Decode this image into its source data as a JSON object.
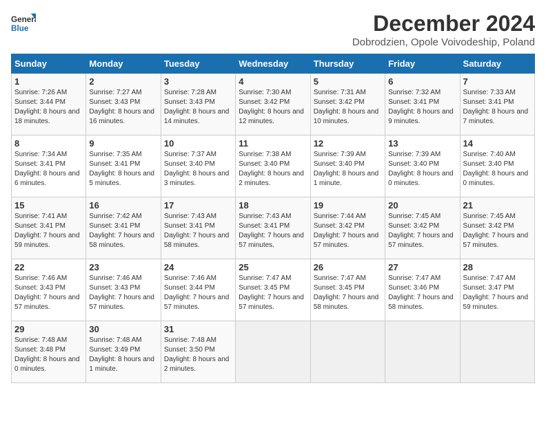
{
  "logo": {
    "line1": "General",
    "line2": "Blue"
  },
  "title": "December 2024",
  "subtitle": "Dobrodzien, Opole Voivodeship, Poland",
  "days_of_week": [
    "Sunday",
    "Monday",
    "Tuesday",
    "Wednesday",
    "Thursday",
    "Friday",
    "Saturday"
  ],
  "weeks": [
    [
      {
        "day": "1",
        "sunrise": "7:26 AM",
        "sunset": "3:44 PM",
        "daylight": "8 hours and 18 minutes."
      },
      {
        "day": "2",
        "sunrise": "7:27 AM",
        "sunset": "3:43 PM",
        "daylight": "8 hours and 16 minutes."
      },
      {
        "day": "3",
        "sunrise": "7:28 AM",
        "sunset": "3:43 PM",
        "daylight": "8 hours and 14 minutes."
      },
      {
        "day": "4",
        "sunrise": "7:30 AM",
        "sunset": "3:42 PM",
        "daylight": "8 hours and 12 minutes."
      },
      {
        "day": "5",
        "sunrise": "7:31 AM",
        "sunset": "3:42 PM",
        "daylight": "8 hours and 10 minutes."
      },
      {
        "day": "6",
        "sunrise": "7:32 AM",
        "sunset": "3:41 PM",
        "daylight": "8 hours and 9 minutes."
      },
      {
        "day": "7",
        "sunrise": "7:33 AM",
        "sunset": "3:41 PM",
        "daylight": "8 hours and 7 minutes."
      }
    ],
    [
      {
        "day": "8",
        "sunrise": "7:34 AM",
        "sunset": "3:41 PM",
        "daylight": "8 hours and 6 minutes."
      },
      {
        "day": "9",
        "sunrise": "7:35 AM",
        "sunset": "3:41 PM",
        "daylight": "8 hours and 5 minutes."
      },
      {
        "day": "10",
        "sunrise": "7:37 AM",
        "sunset": "3:40 PM",
        "daylight": "8 hours and 3 minutes."
      },
      {
        "day": "11",
        "sunrise": "7:38 AM",
        "sunset": "3:40 PM",
        "daylight": "8 hours and 2 minutes."
      },
      {
        "day": "12",
        "sunrise": "7:39 AM",
        "sunset": "3:40 PM",
        "daylight": "8 hours and 1 minute."
      },
      {
        "day": "13",
        "sunrise": "7:39 AM",
        "sunset": "3:40 PM",
        "daylight": "8 hours and 0 minutes."
      },
      {
        "day": "14",
        "sunrise": "7:40 AM",
        "sunset": "3:40 PM",
        "daylight": "8 hours and 0 minutes."
      }
    ],
    [
      {
        "day": "15",
        "sunrise": "7:41 AM",
        "sunset": "3:41 PM",
        "daylight": "7 hours and 59 minutes."
      },
      {
        "day": "16",
        "sunrise": "7:42 AM",
        "sunset": "3:41 PM",
        "daylight": "7 hours and 58 minutes."
      },
      {
        "day": "17",
        "sunrise": "7:43 AM",
        "sunset": "3:41 PM",
        "daylight": "7 hours and 58 minutes."
      },
      {
        "day": "18",
        "sunrise": "7:43 AM",
        "sunset": "3:41 PM",
        "daylight": "7 hours and 57 minutes."
      },
      {
        "day": "19",
        "sunrise": "7:44 AM",
        "sunset": "3:42 PM",
        "daylight": "7 hours and 57 minutes."
      },
      {
        "day": "20",
        "sunrise": "7:45 AM",
        "sunset": "3:42 PM",
        "daylight": "7 hours and 57 minutes."
      },
      {
        "day": "21",
        "sunrise": "7:45 AM",
        "sunset": "3:42 PM",
        "daylight": "7 hours and 57 minutes."
      }
    ],
    [
      {
        "day": "22",
        "sunrise": "7:46 AM",
        "sunset": "3:43 PM",
        "daylight": "7 hours and 57 minutes."
      },
      {
        "day": "23",
        "sunrise": "7:46 AM",
        "sunset": "3:43 PM",
        "daylight": "7 hours and 57 minutes."
      },
      {
        "day": "24",
        "sunrise": "7:46 AM",
        "sunset": "3:44 PM",
        "daylight": "7 hours and 57 minutes."
      },
      {
        "day": "25",
        "sunrise": "7:47 AM",
        "sunset": "3:45 PM",
        "daylight": "7 hours and 57 minutes."
      },
      {
        "day": "26",
        "sunrise": "7:47 AM",
        "sunset": "3:45 PM",
        "daylight": "7 hours and 58 minutes."
      },
      {
        "day": "27",
        "sunrise": "7:47 AM",
        "sunset": "3:46 PM",
        "daylight": "7 hours and 58 minutes."
      },
      {
        "day": "28",
        "sunrise": "7:47 AM",
        "sunset": "3:47 PM",
        "daylight": "7 hours and 59 minutes."
      }
    ],
    [
      {
        "day": "29",
        "sunrise": "7:48 AM",
        "sunset": "3:48 PM",
        "daylight": "8 hours and 0 minutes."
      },
      {
        "day": "30",
        "sunrise": "7:48 AM",
        "sunset": "3:49 PM",
        "daylight": "8 hours and 1 minute."
      },
      {
        "day": "31",
        "sunrise": "7:48 AM",
        "sunset": "3:50 PM",
        "daylight": "8 hours and 2 minutes."
      },
      null,
      null,
      null,
      null
    ]
  ],
  "labels": {
    "sunrise": "Sunrise:",
    "sunset": "Sunset:",
    "daylight": "Daylight:"
  }
}
